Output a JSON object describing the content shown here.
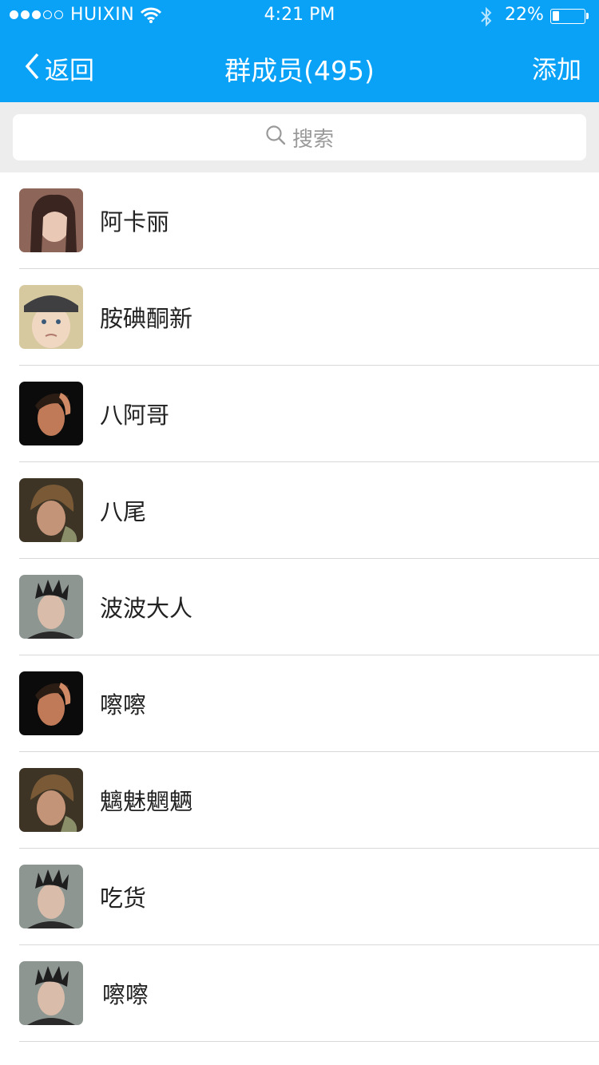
{
  "status_bar": {
    "carrier": "HUIXIN",
    "time": "4:21 PM",
    "battery": "22%",
    "battery_level": 0.22
  },
  "nav": {
    "back_label": "返回",
    "title": "群成员(495)",
    "add_label": "添加"
  },
  "search": {
    "placeholder": "搜索"
  },
  "members": [
    {
      "name": "阿卡丽"
    },
    {
      "name": "胺碘酮新"
    },
    {
      "name": "八阿哥"
    },
    {
      "name": "八尾"
    },
    {
      "name": "波波大人"
    },
    {
      "name": "嚓嚓"
    },
    {
      "name": "魑魅魍魉"
    },
    {
      "name": "吃货"
    },
    {
      "name": "嚓嚓"
    }
  ],
  "colors": {
    "header": "#0aa2f7",
    "search_bg": "#ededed",
    "separator": "#d8d8d8"
  }
}
